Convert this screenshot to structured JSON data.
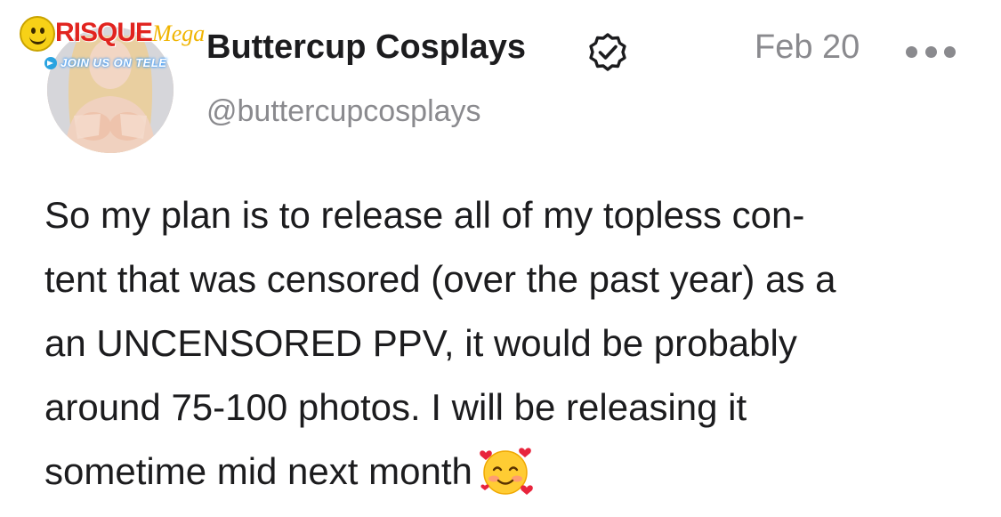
{
  "post": {
    "author_name": "Buttercup Cosplays",
    "handle": "@buttercupcosplays",
    "date": "Feb 20",
    "verified": true,
    "text_lines": [
      "So my plan is to release all of my topless con-",
      "tent that was censored (over the past year) as a",
      "an UNCENSORED PPV, it would be probably",
      "around 75-100 photos. I will be releasing it",
      "sometime mid next month"
    ],
    "emoji": "smiling-face-with-hearts"
  },
  "watermark": {
    "brand": "RISQUE",
    "brand_suffix": "Mega",
    "subtext": "JOIN US ON TELE"
  },
  "icons": {
    "more": "more-horizontal-icon",
    "verified": "verified-badge-icon"
  },
  "colors": {
    "text_primary": "#1c1c1e",
    "text_secondary": "#8a8a8e",
    "watermark_red": "#e1241f",
    "watermark_gold": "#f0b400"
  }
}
